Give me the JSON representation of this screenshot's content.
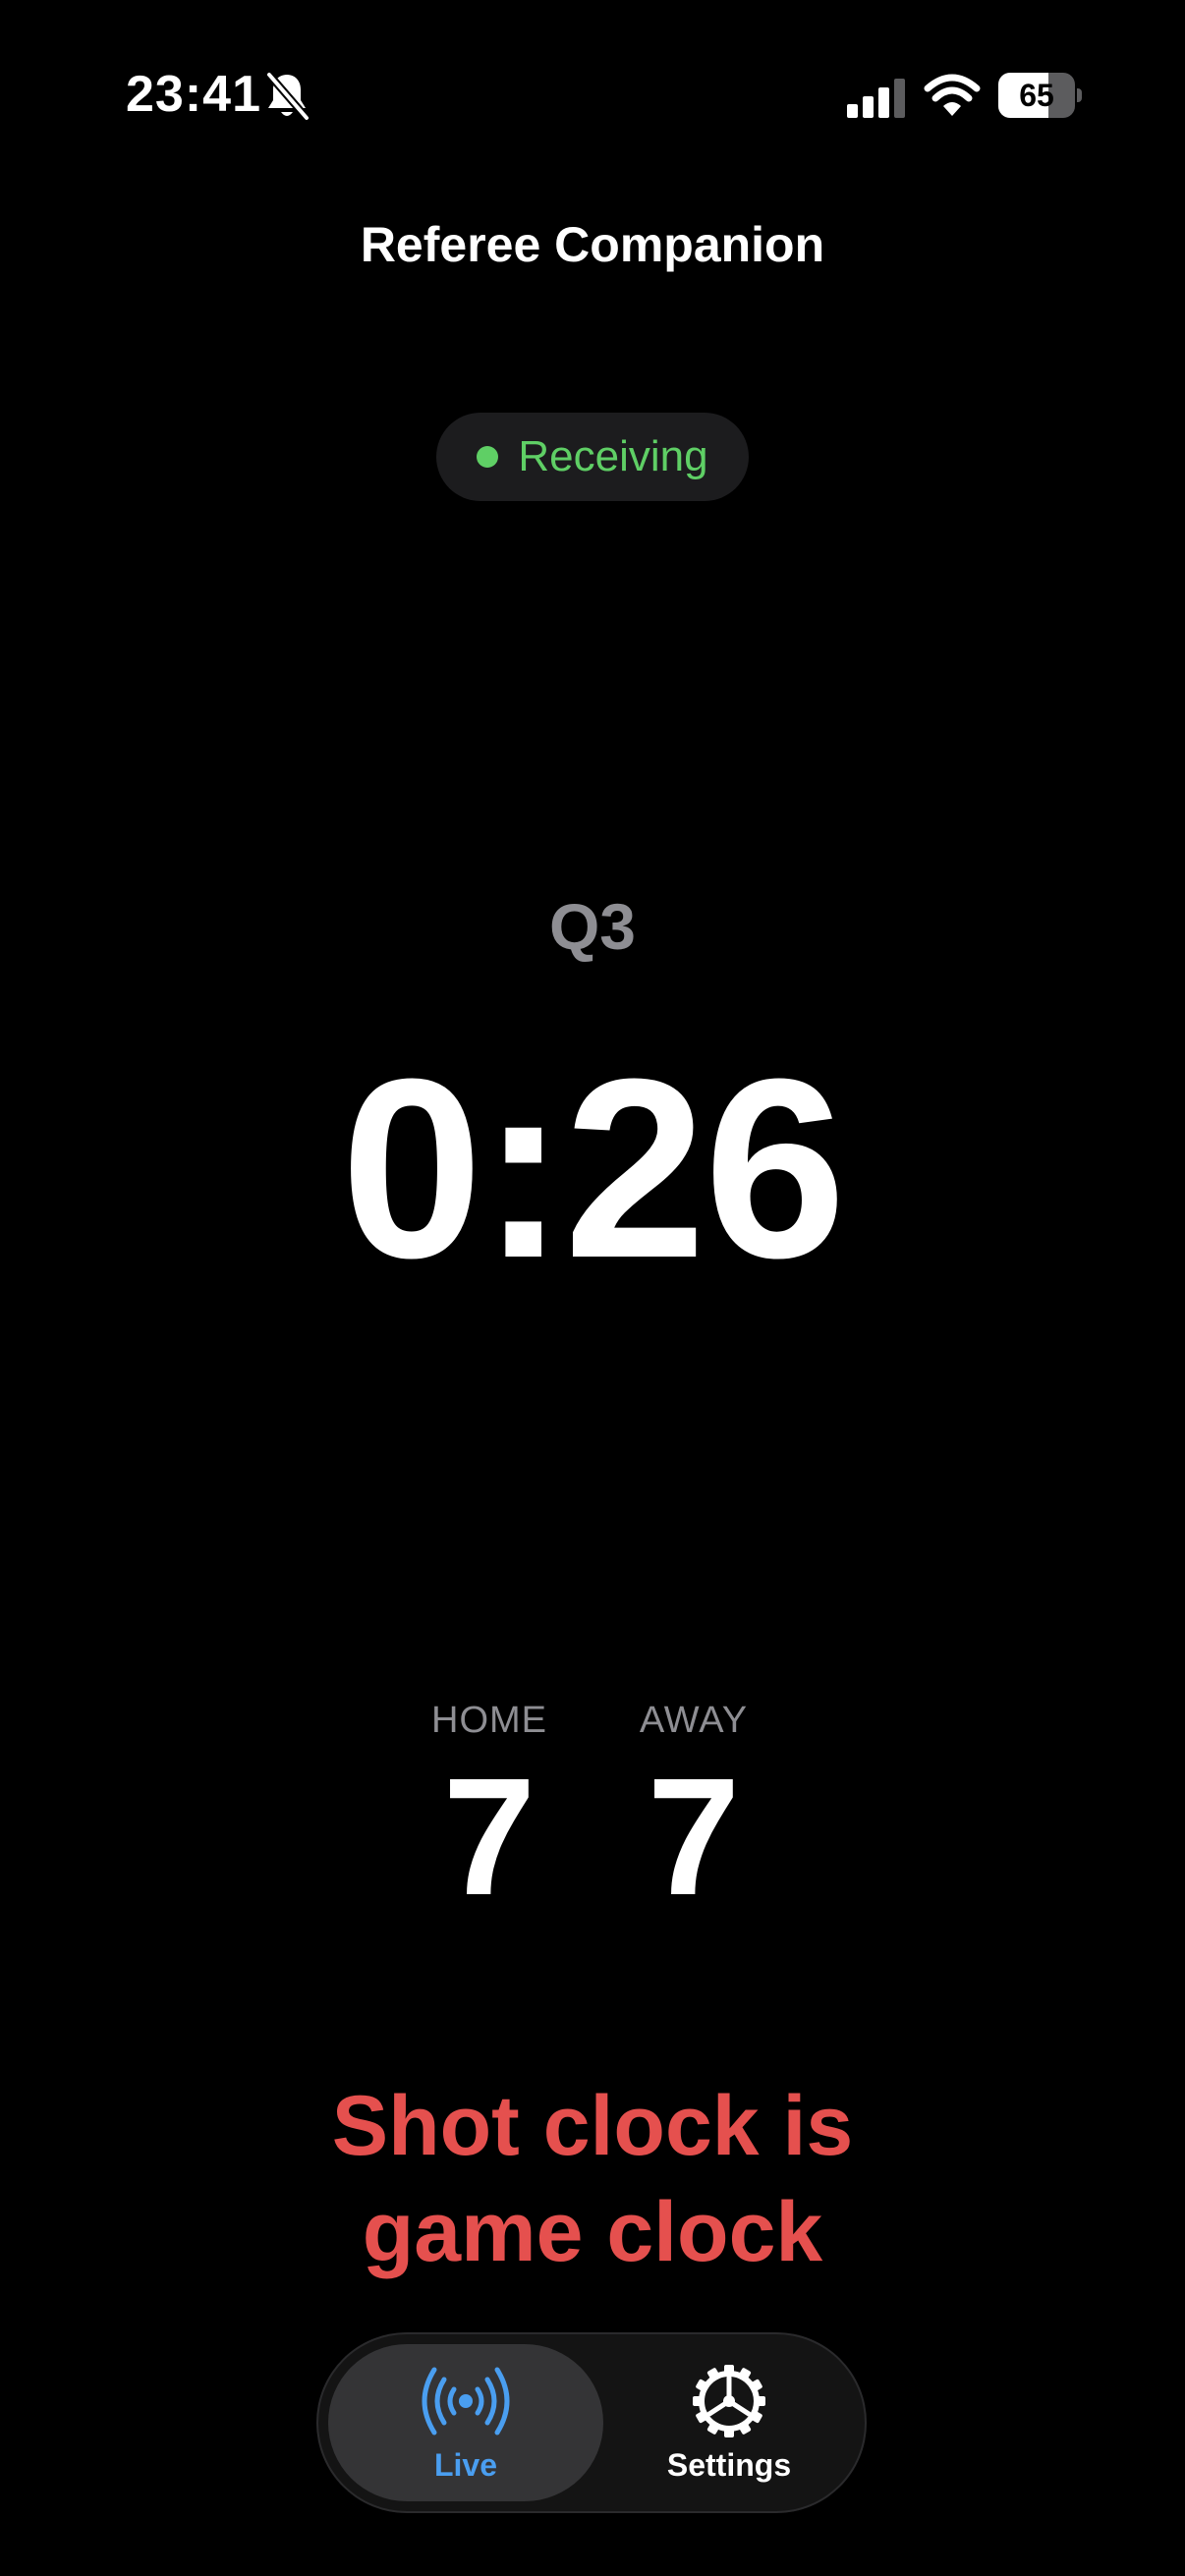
{
  "status_bar": {
    "time": "23:41",
    "battery_level": 65,
    "battery_text": "65",
    "icons": [
      "bell-slash-icon",
      "cellular-signal-icon",
      "wifi-icon",
      "battery-icon"
    ]
  },
  "header": {
    "title": "Referee Companion"
  },
  "connection": {
    "status": "Receiving",
    "status_color": "#5fcf65"
  },
  "game": {
    "period": "Q3",
    "clock": "0:26"
  },
  "score": {
    "home_label": "HOME",
    "home_value": "7",
    "away_label": "AWAY",
    "away_value": "7"
  },
  "alert": {
    "message": "Shot clock is game clock",
    "color": "#e5504e"
  },
  "tab_bar": {
    "tabs": [
      {
        "label": "Live",
        "icon": "broadcast-icon",
        "selected": true,
        "color": "#4a9ef0"
      },
      {
        "label": "Settings",
        "icon": "gear-icon",
        "selected": false,
        "color": "#ffffff"
      }
    ]
  }
}
